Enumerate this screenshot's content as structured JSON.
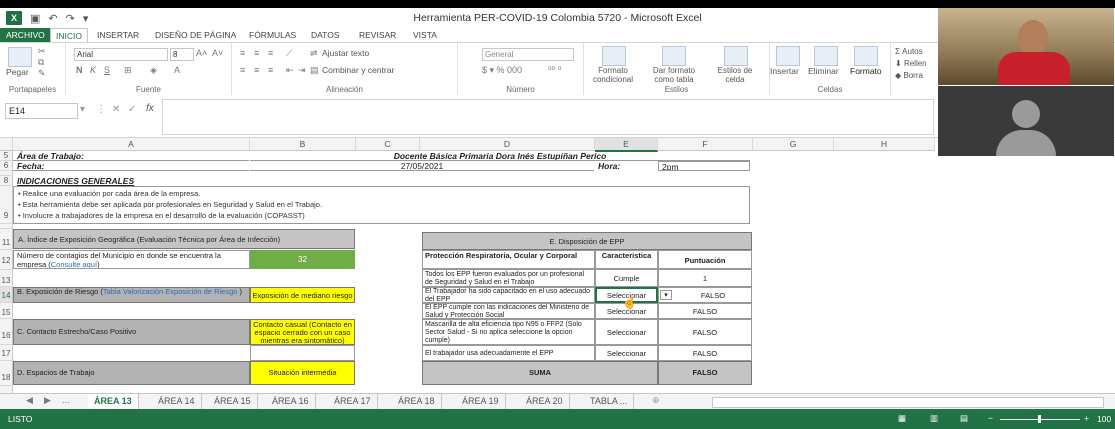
{
  "window": {
    "title": "Herramienta PER-COVID-19 Colombia 5720 - Microsoft Excel"
  },
  "tabs": [
    "ARCHIVO",
    "INICIO",
    "INSERTAR",
    "DISEÑO DE PÁGINA",
    "FÓRMULAS",
    "DATOS",
    "REVISAR",
    "VISTA"
  ],
  "ribbon": {
    "paste": "Pegar",
    "portapapeles": "Portapapeles",
    "font_name": "Arial",
    "font_size": "8",
    "fuente": "Fuente",
    "ajustar": "Ajustar texto",
    "combinar": "Combinar y centrar",
    "alineacion": "Alineación",
    "num_format": "General",
    "numero": "Número",
    "formato_cond": "Formato condicional",
    "dar_formato": "Dar formato como tabla",
    "estilos_celda": "Estilos de celda",
    "estilos": "Estilos",
    "insertar": "Insertar",
    "eliminar": "Eliminar",
    "formato": "Formato",
    "celdas": "Celdas",
    "autos": "Autos",
    "rellen": "Rellen",
    "borra": "Borra"
  },
  "formula_bar": {
    "name_box": "E14",
    "fx": "fx",
    "value": ""
  },
  "columns": [
    "A",
    "B",
    "C",
    "D",
    "E",
    "F",
    "G",
    "H"
  ],
  "rows": {
    "r5": {
      "label": "Área de Trabajo:",
      "value": "Docente Básica Primaria Dora Inés Estupiñan Perico"
    },
    "r6": {
      "label": "Fecha:",
      "value": "27/05/2021",
      "hora_label": "Hora:",
      "hora_value": "2pm"
    },
    "r8": {
      "label": "INDICACIONES GENERALES"
    },
    "indicaciones": [
      "• Realice una evaluación por cada área de la empresa.",
      "• Esta herramienta debe ser aplicada por profesionales en Seguridad y Salud en el Trabajo.",
      "• Involucre a trabajadores de la empresa en el desarrollo de la evaluación (COPASST)"
    ],
    "sectionA": "A. Índice de Exposición Geográfica (Evaluación Técnica por Área de Infección)",
    "r12_a": "Número de contagios del Municipio en donde se encuentra la empresa (",
    "r12_link": "Consulte aquí",
    "r12_b": "32",
    "r14_a": "B. Exposición de Riesgo (",
    "r14_link": "Tabla Valorización Exposición de Riesgo",
    "r14_b": "Exposición de mediano riesgo",
    "r16_a": "C. Contacto Estrecho/Caso Positivo",
    "r16_b": "Contacto casual (Contacto en espacio cerrado con un caso mientras era sintomático)",
    "r18_a": "D. Espacios de Trabajo",
    "r18_b": "Situación intermedia"
  },
  "epp": {
    "title": "E. Disposición de EPP",
    "h1": "Protección Respiratoria, Ocular y Corporal",
    "h2": "Caracteristica",
    "h3": "Puntuación",
    "items": [
      {
        "q": "Todos los EPP fueron evaluados por un profesional de Seguridad y Salud en el Trabajo",
        "c": "Cumple",
        "p": "1"
      },
      {
        "q": "El Trabajador ha sido capacitado en el uso adecuado del EPP",
        "c": "Seleccionar",
        "p": "FALSO"
      },
      {
        "q": "El EPP cumple con las indicaciones del Ministerio de Salud y Protección Social",
        "c": "Seleccionar",
        "p": "FALSO"
      },
      {
        "q": "Mascarilla de alta eficiencia tipo N95 o FFP2 (Solo Sector Salud - Si no aplica seleccione la opcion cumple)",
        "c": "Seleccionar",
        "p": "FALSO"
      },
      {
        "q": "El trabajador usa adecuadamente el EPP",
        "c": "Seleccionar",
        "p": "FALSO"
      }
    ],
    "suma": "SUMA",
    "suma_val": "FALSO"
  },
  "sheet_tabs": [
    "ÁREA 13",
    "ÁREA 14",
    "ÁREA 15",
    "ÁREA 16",
    "ÁREA 17",
    "ÁREA 18",
    "ÁREA 19",
    "ÁREA 20",
    "TABLA ..."
  ],
  "status": {
    "left": "LISTO",
    "zoom": "100"
  },
  "colors": {
    "excel_green": "#217346",
    "yellow": "#ffff00",
    "cell_green": "#70ad47"
  }
}
